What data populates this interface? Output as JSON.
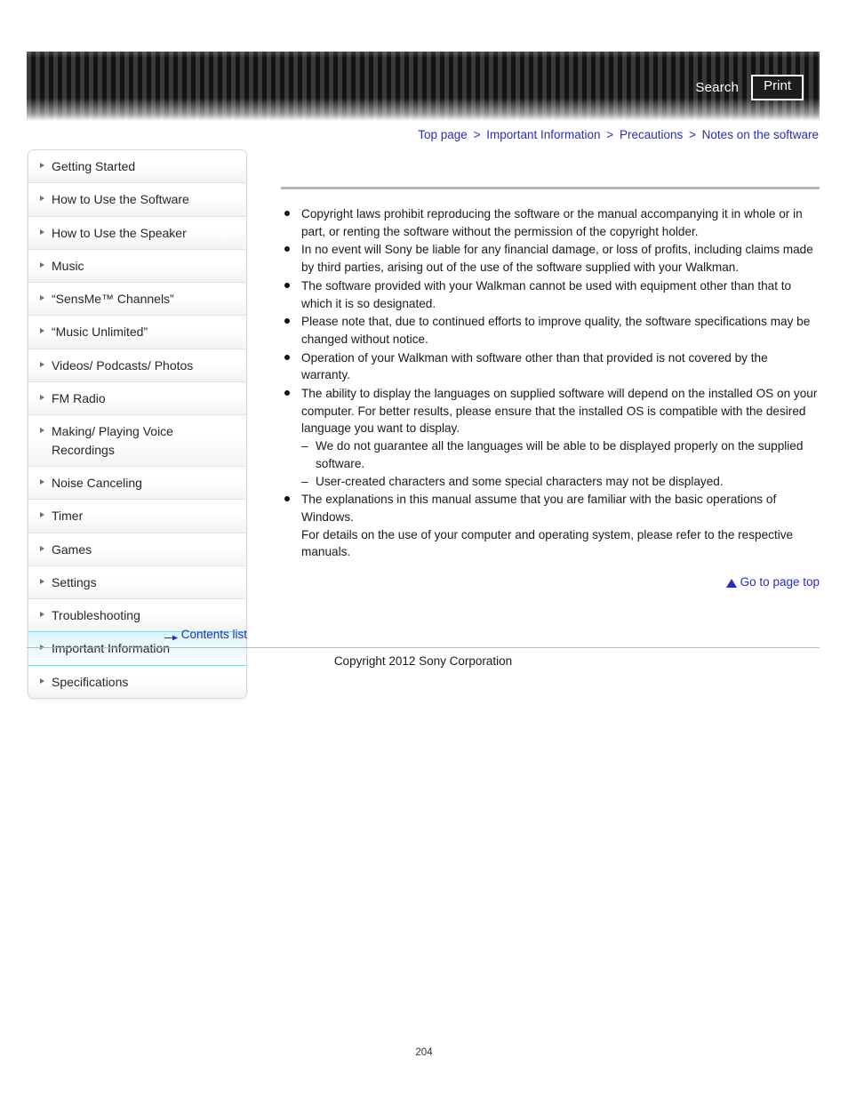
{
  "header": {
    "search_label": "Search",
    "print_label": "Print"
  },
  "breadcrumb": {
    "items": [
      {
        "label": "Top page"
      },
      {
        "label": "Important Information"
      },
      {
        "label": "Precautions"
      },
      {
        "label": "Notes on the software"
      }
    ],
    "separator": ">"
  },
  "sidebar": {
    "items": [
      {
        "label": "Getting Started",
        "active": false
      },
      {
        "label": "How to Use the Software",
        "active": false
      },
      {
        "label": "How to Use the Speaker",
        "active": false
      },
      {
        "label": "Music",
        "active": false
      },
      {
        "label": "“SensMe™ Channels”",
        "active": false
      },
      {
        "label": "“Music Unlimited”",
        "active": false
      },
      {
        "label": "Videos/ Podcasts/ Photos",
        "active": false
      },
      {
        "label": "FM Radio",
        "active": false
      },
      {
        "label": "Making/ Playing Voice Recordings",
        "active": false
      },
      {
        "label": "Noise Canceling",
        "active": false
      },
      {
        "label": "Timer",
        "active": false
      },
      {
        "label": "Games",
        "active": false
      },
      {
        "label": "Settings",
        "active": false
      },
      {
        "label": "Troubleshooting",
        "active": false
      },
      {
        "label": "Important Information",
        "active": true
      },
      {
        "label": "Specifications",
        "active": false
      }
    ],
    "contents_list_label": "Contents list"
  },
  "content": {
    "title": "",
    "bullets": [
      {
        "text": "Copyright laws prohibit reproducing the software or the manual accompanying it in whole or in part, or renting the software without the permission of the copyright holder."
      },
      {
        "text": "In no event will Sony be liable for any financial damage, or loss of profits, including claims made by third parties, arising out of the use of the software supplied with your Walkman."
      },
      {
        "text": "The software provided with your Walkman cannot be used with equipment other than that to which it is so designated."
      },
      {
        "text": "Please note that, due to continued efforts to improve quality, the software specifications may be changed without notice."
      },
      {
        "text": "Operation of your Walkman with software other than that provided is not covered by the warranty."
      },
      {
        "text": "The ability to display the languages on supplied software will depend on the installed OS on your computer. For better results, please ensure that the installed OS is compatible with the desired language you want to display.",
        "subbullets": [
          "We do not guarantee all the languages will be able to be displayed properly on the supplied software.",
          "User-created characters and some special characters may not be displayed."
        ]
      },
      {
        "text": "The explanations in this manual assume that you are familiar with the basic operations of Windows.",
        "extra_paragraph": "For details on the use of your computer and operating system, please refer to the respective manuals."
      }
    ],
    "page_top_label": "Go to page top"
  },
  "footer": {
    "copyright": "Copyright 2012 Sony Corporation",
    "page_number": "204"
  },
  "colors": {
    "link": "#2b2bbd",
    "active_highlight": "#ddf4fb",
    "active_border": "#7fd5ea",
    "rule": "#b5b5b5"
  }
}
